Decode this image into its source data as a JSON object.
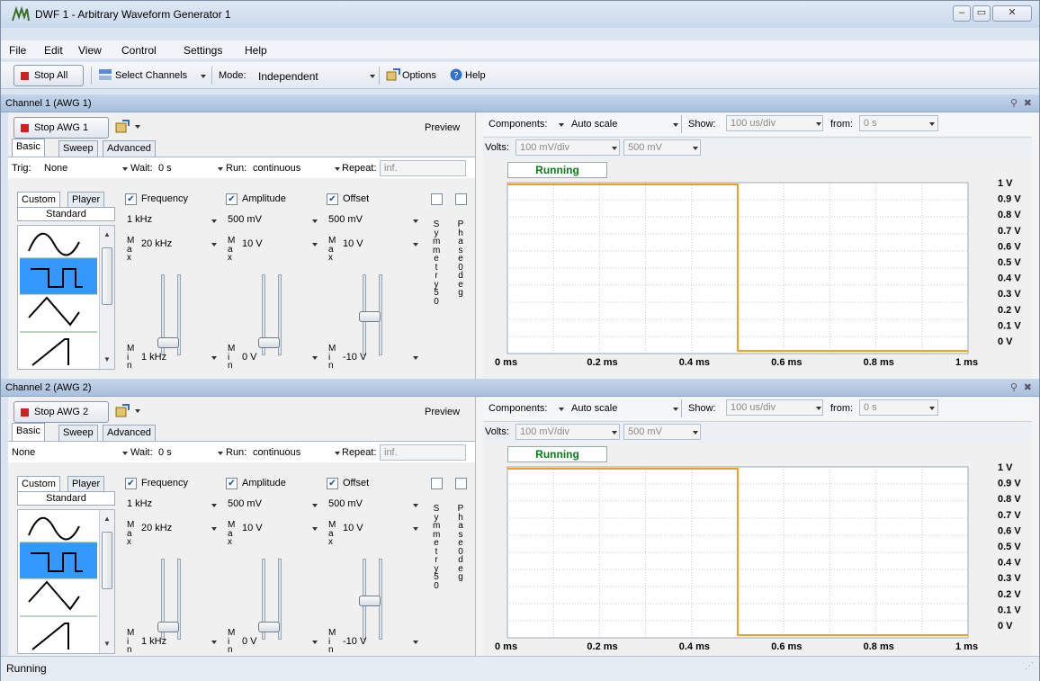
{
  "window": {
    "title": "DWF 1 - Arbitrary Waveform Generator 1"
  },
  "menu": [
    "File",
    "Edit",
    "View",
    "Control",
    "Settings",
    "Help"
  ],
  "toolbar": {
    "stop_all": "Stop All",
    "select_channels": "Select Channels",
    "mode_label": "Mode:",
    "mode_value": "Independent",
    "options": "Options",
    "help": "Help"
  },
  "channels": [
    {
      "header": "Channel 1 (AWG 1)",
      "stop_label": "Stop AWG 1",
      "preview": "Preview",
      "tabs": [
        "Basic",
        "Sweep",
        "Advanced"
      ],
      "trig_label": "Trig:",
      "trig_value": "None",
      "wait_label": "Wait:",
      "wait_value": "0 s",
      "run_label": "Run:",
      "run_value": "continuous",
      "repeat_label": "Repeat:",
      "repeat_value": "inf.",
      "subtabs": [
        "Custom",
        "Player"
      ],
      "standard": "Standard",
      "frequency": {
        "label": "Frequency",
        "value": "1 kHz",
        "max": "20 kHz",
        "min": "1 kHz"
      },
      "amplitude": {
        "label": "Amplitude",
        "value": "500 mV",
        "max": "10 V",
        "min": "0 V"
      },
      "offset": {
        "label": "Offset",
        "value": "500 mV",
        "max": "10 V",
        "min": "-10 V"
      },
      "symmetry": "Symmetry 50",
      "phase": "Phase 0 deg",
      "components_label": "Components:",
      "components_value": "Auto scale",
      "show_label": "Show:",
      "show_value": "100 us/div",
      "from_label": "from:",
      "from_value": "0 s",
      "volts_label": "Volts:",
      "volts_value": "100 mV/div",
      "volts_offset": "500 mV",
      "status": "Running"
    },
    {
      "header": "Channel 2 (AWG 2)",
      "stop_label": "Stop AWG 2",
      "preview": "Preview",
      "tabs": [
        "Basic",
        "Sweep",
        "Advanced"
      ],
      "trig_label": "",
      "trig_value": "None",
      "wait_label": "Wait:",
      "wait_value": "0 s",
      "run_label": "Run:",
      "run_value": "continuous",
      "repeat_label": "Repeat:",
      "repeat_value": "inf.",
      "subtabs": [
        "Custom",
        "Player"
      ],
      "standard": "Standard",
      "frequency": {
        "label": "Frequency",
        "value": "1 kHz",
        "max": "20 kHz",
        "min": "1 kHz"
      },
      "amplitude": {
        "label": "Amplitude",
        "value": "500 mV",
        "max": "10 V",
        "min": "0 V"
      },
      "offset": {
        "label": "Offset",
        "value": "500 mV",
        "max": "10 V",
        "min": "-10 V"
      },
      "symmetry": "Symmetry 50",
      "phase": "Phase 0 deg",
      "components_label": "Components:",
      "components_value": "Auto scale",
      "show_label": "Show:",
      "show_value": "100 us/div",
      "from_label": "from:",
      "from_value": "0 s",
      "volts_label": "Volts:",
      "volts_value": "100 mV/div",
      "volts_offset": "500 mV",
      "status": "Running"
    }
  ],
  "plot_axes": {
    "y_ticks": [
      "1 V",
      "0.9 V",
      "0.8 V",
      "0.7 V",
      "0.6 V",
      "0.5 V",
      "0.4 V",
      "0.3 V",
      "0.2 V",
      "0.1 V",
      "0 V"
    ],
    "x_ticks": [
      "0 ms",
      "0.2 ms",
      "0.4 ms",
      "0.6 ms",
      "0.8 ms",
      "1 ms"
    ]
  },
  "waveform": {
    "color": "#f0a020",
    "high_v": 1,
    "low_v": 0,
    "edge_ms": 0.5,
    "span_ms": 1
  },
  "status_bar": "Running",
  "colors": {
    "stop_red": "#d12020",
    "running_green": "#0a7a1a",
    "selected_wave": "#3399ff"
  }
}
